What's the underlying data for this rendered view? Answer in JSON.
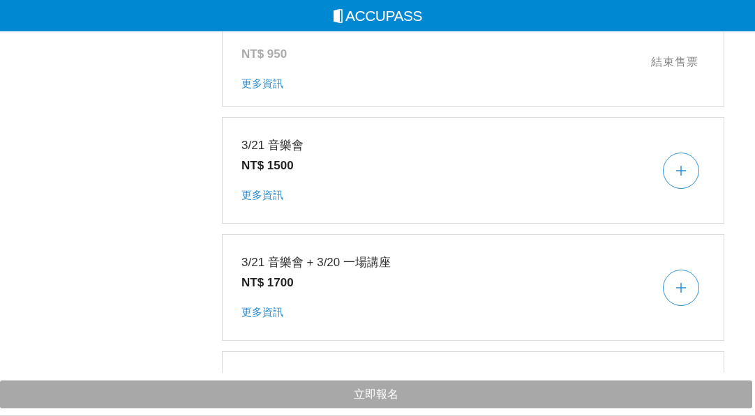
{
  "header": {
    "logo_text": "ACCUPASS"
  },
  "tickets": [
    {
      "kind": "ended",
      "price": "NT$ 950",
      "status": "結束售票",
      "more_link": "更多資訊"
    },
    {
      "kind": "available",
      "title": "3/21 音樂會",
      "price": "NT$ 1500",
      "more_link": "更多資訊"
    },
    {
      "kind": "available",
      "title": "3/21 音樂會 + 3/20 一場講座",
      "price": "NT$ 1700",
      "more_link": "更多資訊"
    }
  ],
  "register_button": {
    "label": "立即報名",
    "disabled": true
  }
}
